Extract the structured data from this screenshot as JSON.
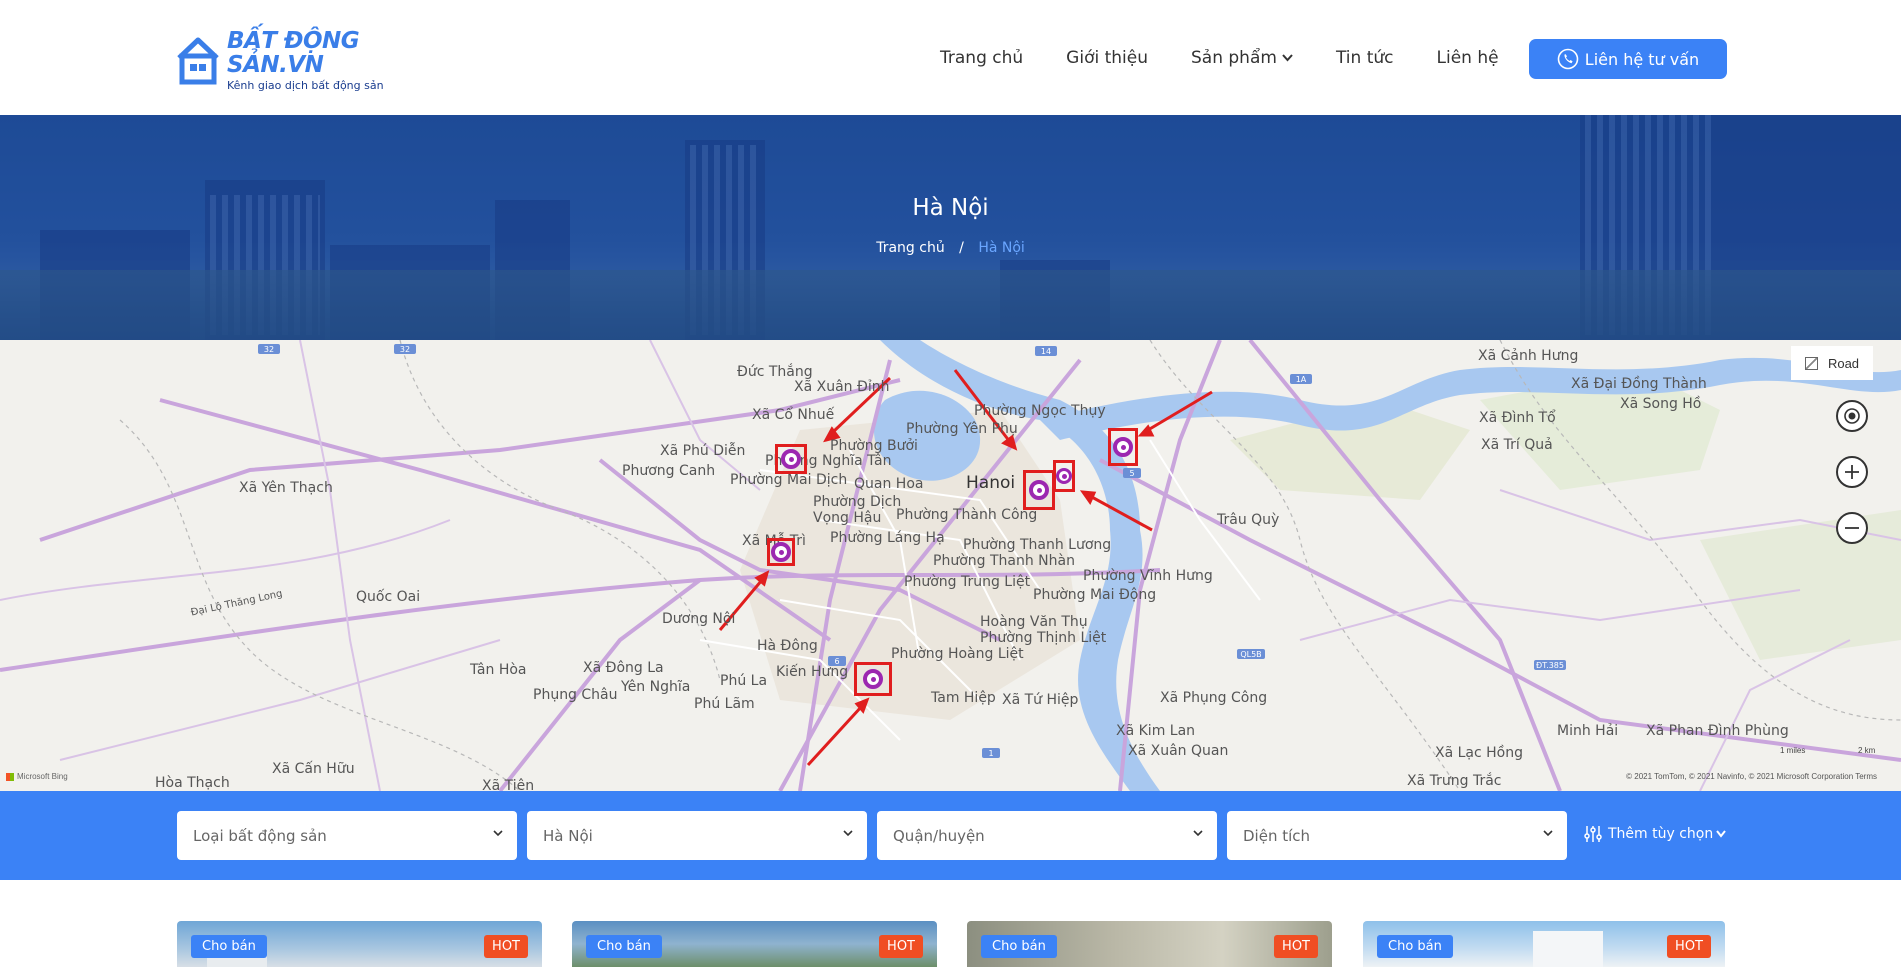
{
  "header": {
    "logo_title": "BẤT ĐỘNG SẢN.VN",
    "logo_subtitle": "Kênh giao dịch bất động sản",
    "nav": [
      {
        "label": "Trang chủ"
      },
      {
        "label": "Giới thiệu"
      },
      {
        "label": "Sản phẩm"
      },
      {
        "label": "Tin tức"
      },
      {
        "label": "Liên hệ"
      }
    ],
    "cta_label": "Liên hệ tư vấn"
  },
  "hero": {
    "title": "Hà Nội",
    "breadcrumb_home": "Trang chủ",
    "breadcrumb_sep": "/",
    "breadcrumb_current": "Hà Nội"
  },
  "map": {
    "road_label": "Road",
    "attribution": "Microsoft Bing",
    "copyright": "© 2021 TomTom, © 2021 Navinfo, © 2021 Microsoft Corporation   Terms",
    "scale_miles": "1 miles",
    "scale_km": "2 km",
    "city_label": "Hanoi",
    "labels": [
      "Đức Thắng",
      "Xã Xuân Đỉnh",
      "Xã Cổ Nhuế",
      "Xã Phú Diễn",
      "Phương Canh",
      "Phường Bưởi",
      "Phường Nghĩa Tân",
      "Phường Mai Dịch",
      "Quan Hoa",
      "Phường Dịch Vọng Hậu",
      "Xã Mễ Trì",
      "Phường Láng Hạ",
      "Phường Thành Công",
      "Phường Thanh Lương",
      "Phường Thanh Nhàn",
      "Phường Trung Liệt",
      "Phường Vĩnh Hưng",
      "Phường Mai Động",
      "Hoàng Văn Thụ",
      "Phường Thịnh Liệt",
      "Phường Hoàng Liệt",
      "Phường Ngọc Thụy",
      "Phường Yên Phụ",
      "Trâu Quỳ",
      "Xã Cảnh Hưng",
      "Xã Đại Đồng Thành",
      "Xã Song Hồ",
      "Xã Đình Tổ",
      "Xã Trí Quả",
      "Xã Yên Thạch",
      "Quốc Oai",
      "Dương Nội",
      "Hà Đông",
      "Tân Hòa",
      "Xã Đông La",
      "Yên Nghĩa",
      "Kiến Hưng",
      "Phú La",
      "Phụng Châu",
      "Phú Lãm",
      "Tam Hiệp",
      "Xã Tứ Hiệp",
      "Xã Kim Lan",
      "Xã Xuân Quan",
      "Xã Phụng Công",
      "Xã Lạc Hồng",
      "Minh Hải",
      "Xã Phan Đình Phùng",
      "Xã Trưng Trắc",
      "Xã Cấn Hữu",
      "Hòa Thạch",
      "Xã Tiên",
      "Đại Lộ Thăng Long"
    ],
    "road_shields": [
      "32",
      "32",
      "14",
      "1A",
      "5",
      "6",
      "1",
      "QL5B",
      "ĐT.385"
    ]
  },
  "search": {
    "fields": [
      {
        "placeholder": "Loại bất động sản"
      },
      {
        "placeholder": "Hà Nội"
      },
      {
        "placeholder": "Quận/huyện"
      },
      {
        "placeholder": "Diện tích"
      }
    ],
    "more_label": "Thêm tùy chọn"
  },
  "cards": [
    {
      "badge": "Cho bán",
      "hot": "HOT"
    },
    {
      "badge": "Cho bán",
      "hot": "HOT"
    },
    {
      "badge": "Cho bán",
      "hot": "HOT"
    },
    {
      "badge": "Cho bán",
      "hot": "HOT"
    }
  ],
  "colors": {
    "primary": "#3b82f6",
    "hot": "#f04e23",
    "pin_box": "#e01e1e",
    "pin": "#9c27b0",
    "river": "#a8c8f0"
  },
  "icons": [
    "phone-icon",
    "chevron-down-icon",
    "locate-icon",
    "zoom-in-icon",
    "zoom-out-icon",
    "sliders-icon",
    "map-pin-icon"
  ]
}
